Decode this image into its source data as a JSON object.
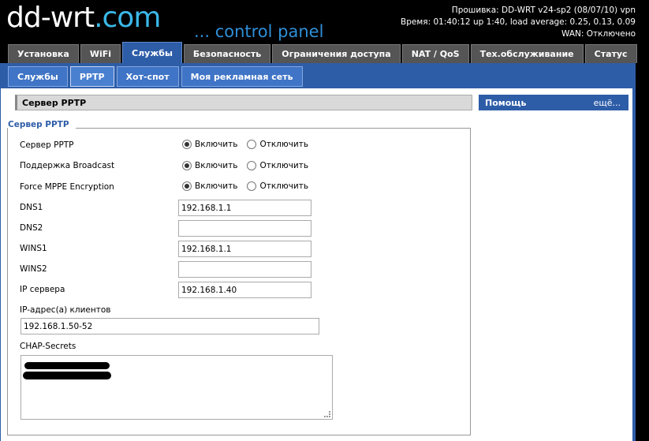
{
  "header": {
    "logo_main": "dd-wrt",
    "logo_suffix": ".com",
    "tagline": "... control panel",
    "firmware": "Прошивка: DD-WRT v24-sp2 (08/07/10) vpn",
    "time": "Время: 01:40:12 up 1:40, load average: 0.25, 0.13, 0.09",
    "wan": "WAN: Отключено"
  },
  "main_tabs": [
    {
      "label": "Установка"
    },
    {
      "label": "WiFi"
    },
    {
      "label": "Службы"
    },
    {
      "label": "Безопасность"
    },
    {
      "label": "Ограничения доступа"
    },
    {
      "label": "NAT / QoS"
    },
    {
      "label": "Тех.обслуживание"
    },
    {
      "label": "Статус"
    }
  ],
  "sub_tabs": [
    {
      "label": "Службы"
    },
    {
      "label": "PPTP"
    },
    {
      "label": "Хот-спот"
    },
    {
      "label": "Моя рекламная сеть"
    }
  ],
  "section_header": "Сервер PPTP",
  "help": {
    "title": "Помощь",
    "more": "ещё..."
  },
  "legend": "Сервер PPTP",
  "radio_on_label": "Включить",
  "radio_off_label": "Отключить",
  "rows": {
    "pptp_server": "Сервер PPTP",
    "broadcast": "Поддержка Broadcast",
    "mppe": "Force MPPE Encryption",
    "dns1": "DNS1",
    "dns2": "DNS2",
    "wins1": "WINS1",
    "wins2": "WINS2",
    "server_ip": "IP сервера",
    "client_ip": "IP-адрес(а) клиентов",
    "chap": "CHAP-Secrets"
  },
  "values": {
    "dns1": "192.168.1.1",
    "dns2": "",
    "wins1": "192.168.1.1",
    "wins2": "",
    "server_ip": "192.168.1.40",
    "client_ip": "192.168.1.50-52"
  }
}
